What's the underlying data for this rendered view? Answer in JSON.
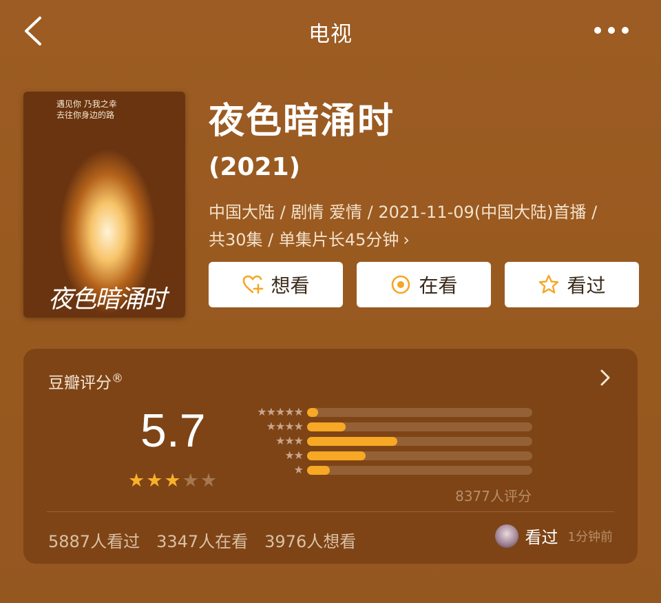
{
  "header": {
    "title": "电视",
    "back_icon": "chevron-left-icon",
    "more_icon": "more-dots-icon"
  },
  "poster": {
    "tagline_1": "遇见你 乃我之幸",
    "tagline_2": "去往你身边的路",
    "logo_text": "夜色暗涌时"
  },
  "show": {
    "title": "夜色暗涌时",
    "year": "(2021)",
    "meta_line_1": "中国大陆 / 剧情 爱情 / 2021-11-09(中国大陆)首播 /",
    "meta_line_2": "共30集 / 单集片长45分钟",
    "meta_chevron": "›"
  },
  "actions": {
    "want": {
      "label": "想看",
      "icon": "heart-plus-icon"
    },
    "watching": {
      "label": "在看",
      "icon": "target-circle-icon"
    },
    "watched": {
      "label": "看过",
      "icon": "star-outline-icon"
    }
  },
  "rating": {
    "title": "豆瓣评分",
    "title_mark": "®",
    "score": "5.7",
    "stars_filled": 3,
    "stars_total": 5,
    "count_text": "8377人评分",
    "distribution": [
      {
        "stars": "★★★★★",
        "fraction": 0.05
      },
      {
        "stars": "★★★★",
        "fraction": 0.17
      },
      {
        "stars": "★★★",
        "fraction": 0.4
      },
      {
        "stars": "★★",
        "fraction": 0.26
      },
      {
        "stars": "★",
        "fraction": 0.1
      }
    ]
  },
  "stats": {
    "watched": "5887人看过",
    "watching": "3347人在看",
    "want": "3976人想看"
  },
  "recent": {
    "label": "看过",
    "time": "1分钟前"
  },
  "colors": {
    "accent": "#f7a824",
    "background": "#9a5a22",
    "card": "#7e4416"
  }
}
